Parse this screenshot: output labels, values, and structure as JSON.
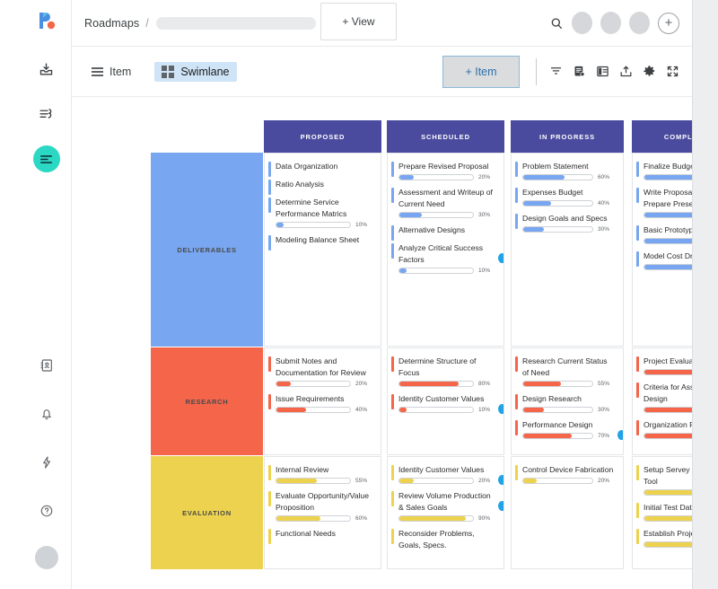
{
  "app": {
    "logo_name": "roadmunk-logo",
    "breadcrumb": "Roadmaps",
    "breadcrumb_separator": "/",
    "view_button": "+ View",
    "search_icon": "search-icon",
    "add_icon": "plus-circle-icon"
  },
  "toolbar": {
    "item_mode": "Item",
    "swimlane_mode": "Swimlane",
    "add_item": "+ Item",
    "icons": [
      "filter-icon",
      "edit-note-icon",
      "columns-layout-icon",
      "export-upload-icon",
      "gear-icon",
      "fullscreen-expand-icon"
    ]
  },
  "sidebar": {
    "top_icons": [
      "inbox-download-icon",
      "task-list-icon",
      "swimlane-board-icon"
    ],
    "bottom_icons": [
      "address-book-icon",
      "bell-icon",
      "lightning-bolt-icon",
      "help-circle-icon"
    ],
    "avatar": "user-avatar"
  },
  "board": {
    "columns": [
      "PROPOSED",
      "SCHEDULED",
      "IN PROGRESS",
      "COMPLETED"
    ],
    "header_color": "#4a4a9e",
    "lanes": [
      {
        "name": "DELIVERABLES",
        "color": "#78a6f0",
        "cells": [
          [
            {
              "title": "Data Organization",
              "pct": null,
              "badge": false
            },
            {
              "title": "Ratio Analysis",
              "pct": null,
              "badge": false
            },
            {
              "title": "Determine Service Performance Matrics",
              "pct": 10,
              "badge": false
            },
            {
              "title": "Modeling Balance Sheet",
              "pct": null,
              "badge": false
            }
          ],
          [
            {
              "title": "Prepare Revised Proposal",
              "pct": 20,
              "badge": false
            },
            {
              "title": "Assessment and Writeup of  Current Need",
              "pct": 30,
              "badge": false
            },
            {
              "title": "Alternative Designs",
              "pct": null,
              "badge": false
            },
            {
              "title": "Analyze Critical Success Factors",
              "pct": 10,
              "badge": true
            }
          ],
          [
            {
              "title": "Problem Statement",
              "pct": 60,
              "badge": false
            },
            {
              "title": "Expenses Budget",
              "pct": 40,
              "badge": false
            },
            {
              "title": "Design Goals and Specs",
              "pct": 30,
              "badge": false
            }
          ],
          [
            {
              "title": "Finalize Budget Report",
              "pct": 100,
              "badge": false
            },
            {
              "title": "Write Proposal and Prepare Presentation",
              "pct": 100,
              "badge": false
            },
            {
              "title": "Basic Prototype",
              "pct": 100,
              "badge": false
            },
            {
              "title": "Model Cost Drivers",
              "pct": 100,
              "badge": false
            }
          ]
        ]
      },
      {
        "name": "RESEARCH",
        "color": "#f4654a",
        "cells": [
          [
            {
              "title": "Submit Notes and Documentation for Review",
              "pct": 20,
              "badge": false
            },
            {
              "title": "Issue Requirements",
              "pct": 40,
              "badge": false
            }
          ],
          [
            {
              "title": "Determine Structure of Focus",
              "pct": 80,
              "badge": false
            },
            {
              "title": "Identity Customer Values",
              "pct": 10,
              "badge": true
            }
          ],
          [
            {
              "title": "Research Current Status of Need",
              "pct": 55,
              "badge": false
            },
            {
              "title": "Design Research",
              "pct": 30,
              "badge": false
            },
            {
              "title": "Performance Design",
              "pct": 70,
              "badge": true
            }
          ],
          [
            {
              "title": "Project Evaluation",
              "pct": 100,
              "badge": false
            },
            {
              "title": "Criteria for Assessment of Design",
              "pct": 100,
              "badge": true
            },
            {
              "title": "Organization  Focus  Group",
              "pct": 100,
              "badge": false
            }
          ]
        ]
      },
      {
        "name": "EVALUATION",
        "color": "#ecd24e",
        "cells": [
          [
            {
              "title": "Internal Review",
              "pct": 55,
              "badge": false
            },
            {
              "title": "Evaluate Opportunity/Value Proposition",
              "pct": 60,
              "badge": false
            },
            {
              "title": "Functional Needs",
              "pct": null,
              "badge": false
            }
          ],
          [
            {
              "title": "Identity Customer Values",
              "pct": 20,
              "badge": true
            },
            {
              "title": "Review Volume Production & Sales Goals",
              "pct": 90,
              "badge": true
            },
            {
              "title": "Reconsider Problems, Goals, Specs.",
              "pct": null,
              "badge": false
            }
          ],
          [
            {
              "title": "Control Device Fabrication",
              "pct": 20,
              "badge": false
            }
          ],
          [
            {
              "title": "Setup Servey in Online Tool",
              "pct": 100,
              "badge": false
            },
            {
              "title": "Initial Test Data",
              "pct": 100,
              "badge": false
            },
            {
              "title": "Establish Project Team",
              "pct": 100,
              "badge": true
            }
          ]
        ]
      }
    ]
  }
}
